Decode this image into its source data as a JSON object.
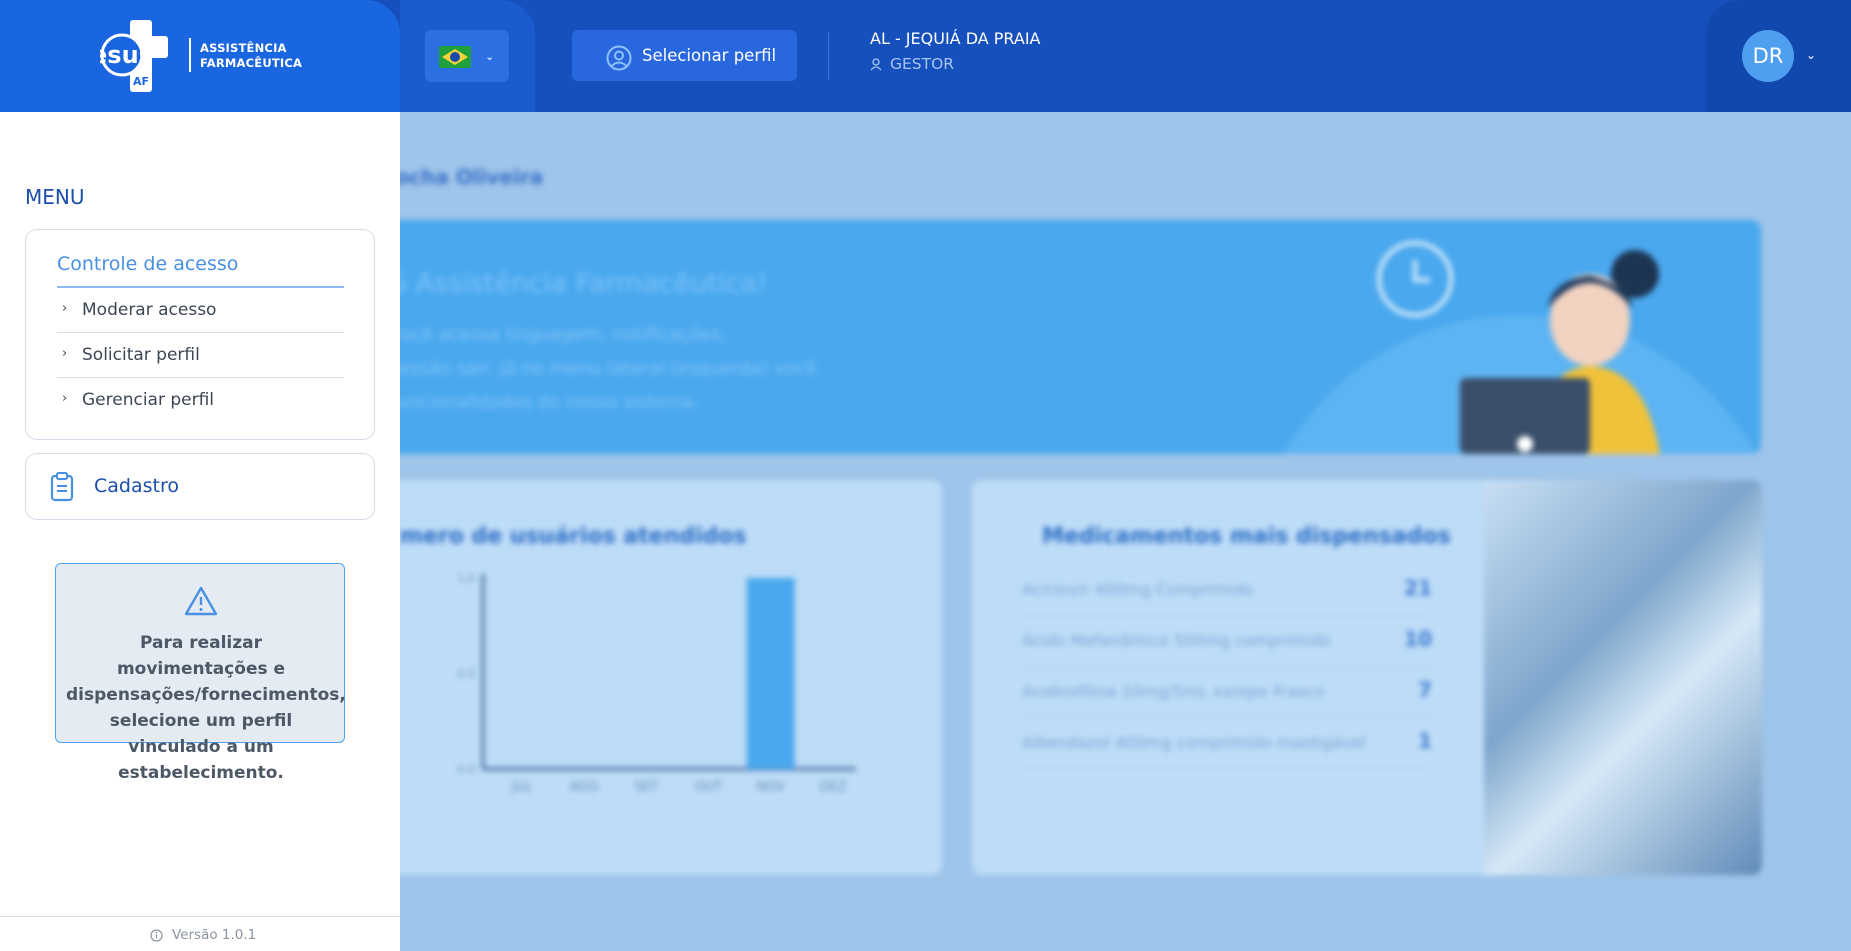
{
  "header": {
    "logo_text_line1": "ASSISTÊNCIA",
    "logo_text_line2": "FARMACÊUTICA",
    "logo_mark_text": "esus",
    "logo_mark_sub": "AF",
    "flag_icon": "brazil-flag-icon",
    "select_profile_label": "Selecionar perfil",
    "location": "AL - JEQUIÁ DA PRAIA",
    "role": "GESTOR",
    "avatar_initials": "DR"
  },
  "sidebar": {
    "menu_title": "MENU",
    "access_section": {
      "title": "Controle de acesso",
      "items": [
        {
          "label": "Moderar acesso"
        },
        {
          "label": "Solicitar perfil"
        },
        {
          "label": "Gerenciar perfil"
        }
      ]
    },
    "cadastro_label": "Cadastro",
    "warning_message": "Para realizar movimentações e dispensações/fornecimentos, selecione um perfil vinculado a um estabelecimento.",
    "version": "Versão 1.0.1"
  },
  "background": {
    "greeting": "Rocha Oliveira",
    "banner_title": "S Assistência Farmacêutica!",
    "banner_lines": [
      "você acessa linguagem, notificações,",
      "sessão sair. Já no menu lateral (esquerda) você",
      "funcionalidades do nosso sistema."
    ],
    "left_card_title": "mero de usuários atendidos",
    "right_card_title": "Medicamentos mais dispensados",
    "medications": [
      {
        "name": "Aciclovir 400mg Comprimido",
        "value": "21"
      },
      {
        "name": "Ácido Mefenâmico 500mg comprimido",
        "value": "10"
      },
      {
        "name": "Acebrofilina 10mg/5mL xarope Frasco",
        "value": "7"
      },
      {
        "name": "Albendazol 400mg comprimido mastigável",
        "value": "1"
      }
    ]
  },
  "chart_data": {
    "type": "bar",
    "categories": [
      "JUL",
      "AGO",
      "SET",
      "OUT",
      "NOV",
      "DEZ"
    ],
    "values": [
      0,
      0,
      0,
      0,
      1.0,
      0
    ],
    "ylim": [
      0,
      1.0
    ],
    "yticks": [
      "1.0",
      "0.5",
      "0.0"
    ],
    "bar_color": "#4aa8ee"
  }
}
